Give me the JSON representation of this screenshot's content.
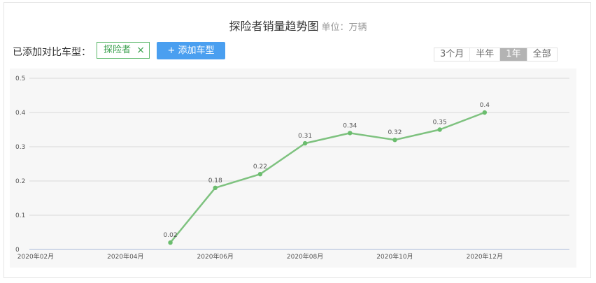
{
  "header": {
    "title": "探险者销量趋势图",
    "unit_label": "单位：万辆"
  },
  "compare": {
    "label": "已添加对比车型：",
    "model_tag": "探险者",
    "remove_symbol": "×",
    "add_button": "+ 添加车型"
  },
  "range_tabs": [
    "3个月",
    "半年",
    "1年",
    "全部"
  ],
  "active_range": "1年",
  "colors": {
    "line": "#7ec27f",
    "point": "#6bbd6e",
    "active_tab": "#b3b3b3",
    "add_button": "#4a9ff0"
  },
  "chart_data": {
    "type": "line",
    "title": "探险者销量趋势图",
    "ylabel": "",
    "xlabel": "",
    "x_ticks": [
      "2020年02月",
      "2020年04月",
      "2020年06月",
      "2020年08月",
      "2020年10月",
      "2020年12月"
    ],
    "y_ticks": [
      "0",
      "0.1",
      "0.2",
      "0.3",
      "0.4",
      "0.5"
    ],
    "ylim": [
      0,
      0.5
    ],
    "grid": true,
    "series": [
      {
        "x": [
          "2020年05月",
          "2020年06月",
          "2020年07月",
          "2020年08月",
          "2020年09月",
          "2020年10月",
          "2020年11月",
          "2020年12月"
        ],
        "values": [
          0.02,
          0.18,
          0.22,
          0.31,
          0.34,
          0.32,
          0.35,
          0.4
        ]
      }
    ]
  }
}
